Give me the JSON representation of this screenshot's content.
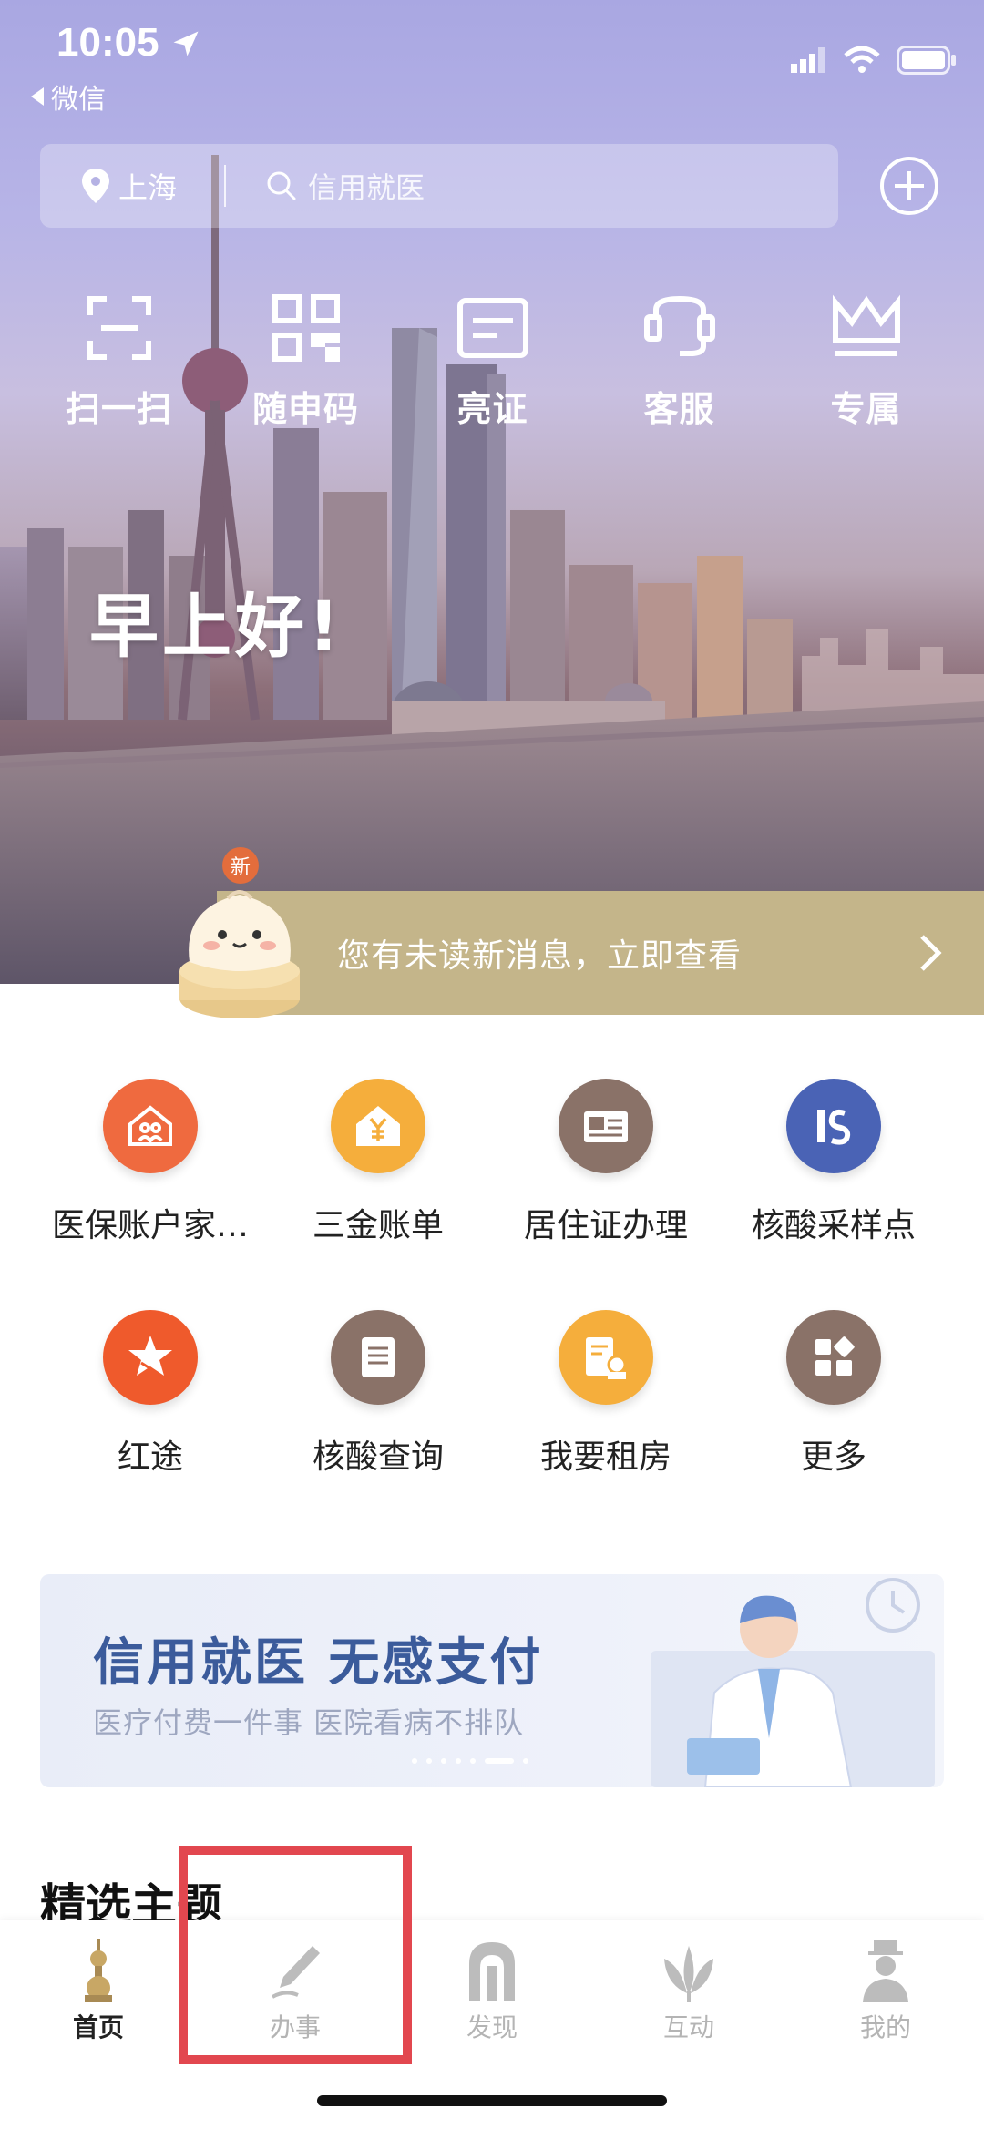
{
  "status_bar": {
    "time": "10:05",
    "back_app": "微信"
  },
  "search": {
    "location": "上海",
    "placeholder": "信用就医"
  },
  "quick_actions": [
    {
      "label": "扫一扫",
      "icon": "scan-icon"
    },
    {
      "label": "随申码",
      "icon": "qr-code-icon"
    },
    {
      "label": "亮证",
      "icon": "card-icon"
    },
    {
      "label": "客服",
      "icon": "headset-icon"
    },
    {
      "label": "专属",
      "icon": "crown-icon"
    }
  ],
  "greeting": "早上好!",
  "message_banner": {
    "badge": "新",
    "text": "您有未读新消息，立即查看"
  },
  "services": [
    [
      {
        "label": "医保账户家…",
        "icon": "family-house-icon",
        "color": "#ef6a3f"
      },
      {
        "label": "三金账单",
        "icon": "yuan-house-icon",
        "color": "#f5ae3c"
      },
      {
        "label": "居住证办理",
        "icon": "residence-card-icon",
        "color": "#8a7268"
      },
      {
        "label": "核酸采样点",
        "icon": "is-logo-icon",
        "color": "#4a63b5"
      }
    ],
    [
      {
        "label": "红途",
        "icon": "star-icon",
        "color": "#ef5a2c"
      },
      {
        "label": "核酸查询",
        "icon": "document-icon",
        "color": "#8a7268"
      },
      {
        "label": "我要租房",
        "icon": "rental-icon",
        "color": "#f5ae3c"
      },
      {
        "label": "更多",
        "icon": "grid-more-icon",
        "color": "#8a7268"
      }
    ]
  ],
  "promo": {
    "title": "信用就医  无感支付",
    "subtitle": "医疗付费一件事 医院看病不排队",
    "dots": 7,
    "active_dot": 5
  },
  "section_title": "精选主题",
  "tabs": [
    {
      "label": "首页",
      "icon": "home-tower-icon",
      "active": true
    },
    {
      "label": "办事",
      "icon": "pen-icon",
      "active": false
    },
    {
      "label": "发现",
      "icon": "arch-icon",
      "active": false
    },
    {
      "label": "互动",
      "icon": "magnolia-icon",
      "active": false
    },
    {
      "label": "我的",
      "icon": "person-icon",
      "active": false
    }
  ],
  "colors": {
    "banner": "#c4b58a",
    "highlight": "#e2474f",
    "promo_title": "#3b5b9b"
  }
}
